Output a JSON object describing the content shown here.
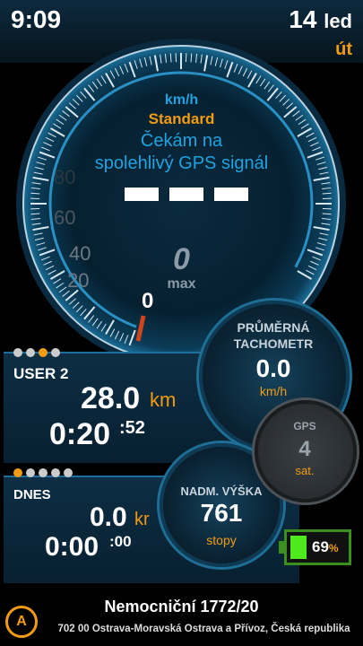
{
  "status": {
    "time": "9:09",
    "day": "14",
    "month": "led",
    "weekday": "út"
  },
  "speedometer": {
    "unit": "km/h",
    "mode": "Standard",
    "message_line1": "Čekám na",
    "message_line2": "spolehlivý GPS signál",
    "current_speed": "– – –",
    "max_value": "0",
    "max_label": "max",
    "scale_labels": [
      "20",
      "40",
      "60",
      "80"
    ],
    "zero_label": "0",
    "accent_color": "#1fa3e0",
    "needle_color": "#d0441c"
  },
  "panel_user": {
    "dots": [
      false,
      false,
      true,
      false
    ],
    "name": "USER 2",
    "distance": "28.0",
    "distance_unit": "km",
    "time": "0:20",
    "time_sec": ":52"
  },
  "panel_today": {
    "dots": [
      true,
      false,
      false,
      false,
      false
    ],
    "name": "DNES",
    "distance": "0.0",
    "distance_unit": "kr",
    "time": "0:00",
    "time_sec": ":00"
  },
  "average": {
    "label_line1": "PRŮMĚRNÁ",
    "label_line2": "TACHOMETR",
    "value": "0.0",
    "unit": "km/h"
  },
  "gps": {
    "label": "GPS",
    "value": "4",
    "unit": "sat."
  },
  "altitude": {
    "label": "NADM. VÝŠKA",
    "value": "761",
    "unit": "stopy"
  },
  "battery": {
    "percent": "69",
    "percent_sign": "%",
    "level": 0.69
  },
  "address": {
    "street": "Nemocniční 1772/20",
    "city": "702 00 Ostrava-Moravská Ostrava a Přívoz, Česká republika",
    "anchor_letter": "A"
  },
  "colors": {
    "orange": "#f39c12",
    "blue": "#1fa3e0",
    "green": "#4eea1e"
  }
}
